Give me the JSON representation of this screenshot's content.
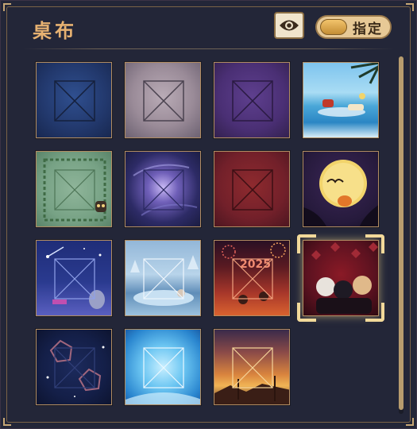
{
  "header": {
    "title": "桌布",
    "toggle_label": "指定",
    "eye_icon": "eye-icon"
  },
  "colors": {
    "accent_gold": "#e6b171",
    "panel_bg": "#232638",
    "selection": "#f2d99a"
  },
  "tiles": [
    {
      "id": "blue"
    },
    {
      "id": "mauve"
    },
    {
      "id": "purple"
    },
    {
      "id": "beach"
    },
    {
      "id": "green-wreath"
    },
    {
      "id": "night-sky"
    },
    {
      "id": "red"
    },
    {
      "id": "halloween-moon"
    },
    {
      "id": "starry-blue"
    },
    {
      "id": "snowy-forest"
    },
    {
      "id": "fireworks-2025"
    },
    {
      "id": "hearts-chibi",
      "selected": true
    },
    {
      "id": "navy-stars"
    },
    {
      "id": "sky-blue"
    },
    {
      "id": "sunset"
    }
  ]
}
